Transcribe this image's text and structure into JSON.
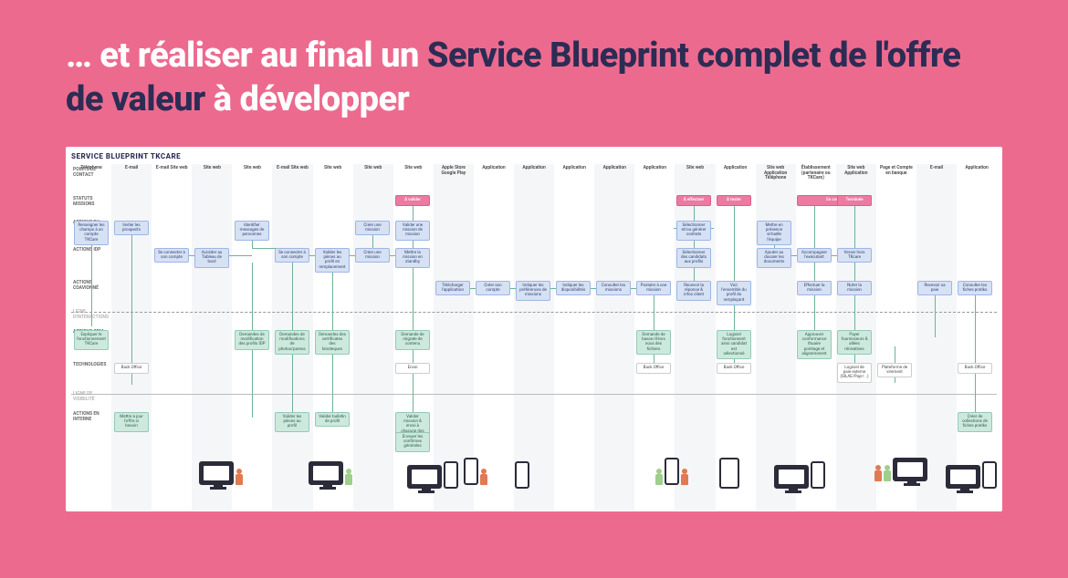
{
  "heading": {
    "pre": "… et réaliser au final un ",
    "mid": "Service Blueprint complet de l'offre de valeur",
    "post": " à développer"
  },
  "blueprint": {
    "title": "SERVICE BLUEPRINT TKCARE",
    "rows": {
      "points_contact": "POINTS DE CONTACT",
      "statuts_missions": "STATUTS MISSIONS",
      "actions_rh": "ACTIONS RH",
      "actions_idp": "ACTIONS IDP",
      "actions_coavionne": "ACTIONS COAVIONNÉ",
      "ligne_interactions": "LIGNE D'INTERACTIONS",
      "actions_crm": "ACTIONS CRM",
      "technologies": "TECHNOLOGIES",
      "ligne_visibilite": "LIGNE DE VISIBILITÉ",
      "actions_interne": "ACTIONS EN INTERNE"
    },
    "columns": [
      "Téléphone",
      "E-mail",
      "E-mail Site web",
      "Site web",
      "Site web",
      "E-mail Site web",
      "Site web",
      "Site web",
      "Site web",
      "Apple Store Google Play",
      "Application",
      "Application",
      "Application",
      "Application",
      "Application",
      "Site web",
      "Application",
      "Site web Application Téléphone",
      "Établissement (partenaire ou TKCare)",
      "Site web Application",
      "Page et Compte en banque",
      "E-mail",
      "Application"
    ],
    "statuses": [
      {
        "col": 8,
        "label": "À valider"
      },
      {
        "col": 15,
        "label": "À effectuer"
      },
      {
        "col": 16,
        "label": "À tester"
      },
      {
        "col": 18,
        "label": "En cours",
        "span": 2
      },
      {
        "col": 19,
        "label": "Terminée"
      }
    ],
    "nodes_blue": [
      {
        "col": 0,
        "row": "rh",
        "label": "Renseigner les champs à un compte TKCare"
      },
      {
        "col": 1,
        "row": "rh",
        "label": "Inviter les prospects"
      },
      {
        "col": 2,
        "row": "idp",
        "label": "Se connecter à son compte"
      },
      {
        "col": 3,
        "row": "idp",
        "label": "Accéder au Tableau de bord"
      },
      {
        "col": 4,
        "row": "rh",
        "label": "Identifier messages de personnes"
      },
      {
        "col": 5,
        "row": "idp",
        "label": "Se connecter à son compte"
      },
      {
        "col": 6,
        "row": "idp",
        "label": "Valider les pièces au profil en remplacement"
      },
      {
        "col": 7,
        "row": "idp",
        "label": "Créer une mission"
      },
      {
        "col": 7,
        "row": "rh",
        "label": "Créer une mission"
      },
      {
        "col": 8,
        "row": "idp",
        "label": "Mettre la mission en standby"
      },
      {
        "col": 8,
        "row": "rh",
        "label": "Valider une mission de mission"
      },
      {
        "col": 9,
        "row": "coav",
        "label": "Télécharger l'application"
      },
      {
        "col": 10,
        "row": "coav",
        "label": "Créer son compte"
      },
      {
        "col": 11,
        "row": "coav",
        "label": "Indiquer les préférences de missions"
      },
      {
        "col": 12,
        "row": "coav",
        "label": "Indiquer les disponibilités"
      },
      {
        "col": 13,
        "row": "coav",
        "label": "Consulter les missions"
      },
      {
        "col": 14,
        "row": "coav",
        "label": "Postuler à une mission"
      },
      {
        "col": 15,
        "row": "rh",
        "label": "Sélectionner et/ou générer contrats"
      },
      {
        "col": 15,
        "row": "idp",
        "label": "Sélectionner des candidats aux profils"
      },
      {
        "col": 15,
        "row": "coav",
        "label": "Recevoir la réponse & infos client"
      },
      {
        "col": 16,
        "row": "coav",
        "label": "Voir l'ensemble du profil du remplaçant"
      },
      {
        "col": 17,
        "row": "rh",
        "label": "Mettre en présence virtuelle l'équipe"
      },
      {
        "col": 17,
        "row": "idp",
        "label": "Ajouter au dossier les documents"
      },
      {
        "col": 18,
        "row": "idp",
        "label": "Accompagner l'exécutant"
      },
      {
        "col": 18,
        "row": "coav",
        "label": "Effectuer la mission"
      },
      {
        "col": 19,
        "row": "idp",
        "label": "Verser hors TKcare"
      },
      {
        "col": 19,
        "row": "coav",
        "label": "Noter la mission"
      },
      {
        "col": 21,
        "row": "coav",
        "label": "Recevoir sa paie"
      },
      {
        "col": 22,
        "row": "coav",
        "label": "Consulter les fiches pratiks"
      }
    ],
    "nodes_mint": [
      {
        "col": 0,
        "row": "crm",
        "label": "Expliquer le fonctionnement TKCare"
      },
      {
        "col": 1,
        "row": "interne",
        "label": "Mettre à jour l'offre si besoin"
      },
      {
        "col": 4,
        "row": "crm",
        "label": "Demandes de modification des profils IDP"
      },
      {
        "col": 5,
        "row": "crm",
        "label": "Demandes de modifications de photos/pareos"
      },
      {
        "col": 5,
        "row": "interne",
        "label": "Valider les pièces au profil"
      },
      {
        "col": 6,
        "row": "crm",
        "label": "Demandes des certificates des binoteques"
      },
      {
        "col": 6,
        "row": "interne",
        "label": "Valider bulletin de profil"
      },
      {
        "col": 8,
        "row": "crm",
        "label": "Demande de migrate de contenu"
      },
      {
        "col": 8,
        "row": "interne",
        "label": "Valider mission & envoi à chacune des IDP"
      },
      {
        "col": 8,
        "row": "interne2",
        "label": "Envoyer les confirmes générales"
      },
      {
        "col": 14,
        "row": "crm",
        "label": "Demande de basse n'Hors nous des fichiers"
      },
      {
        "col": 16,
        "row": "crm",
        "label": "Logiciel fonctionnent ainsi candidat est sélectionné"
      },
      {
        "col": 18,
        "row": "crm",
        "label": "Approuver conformance thuaire pointage et alignemenent"
      },
      {
        "col": 19,
        "row": "crm",
        "label": "Payer fournisseurs & allées rénivatives"
      },
      {
        "col": 22,
        "row": "interne",
        "label": "Créer de collections de fiches pratiks"
      }
    ],
    "nodes_tech": [
      {
        "col": 1,
        "label": "Back Office"
      },
      {
        "col": 8,
        "label": "Envoi"
      },
      {
        "col": 14,
        "label": "Back Office"
      },
      {
        "col": 16,
        "label": "Back Office"
      },
      {
        "col": 19,
        "label": "Logiciel de paie externe (SILAE/Payr/...)"
      },
      {
        "col": 20,
        "label": "Plateforme de virement"
      },
      {
        "col": 22,
        "label": "Back Office"
      }
    ]
  }
}
